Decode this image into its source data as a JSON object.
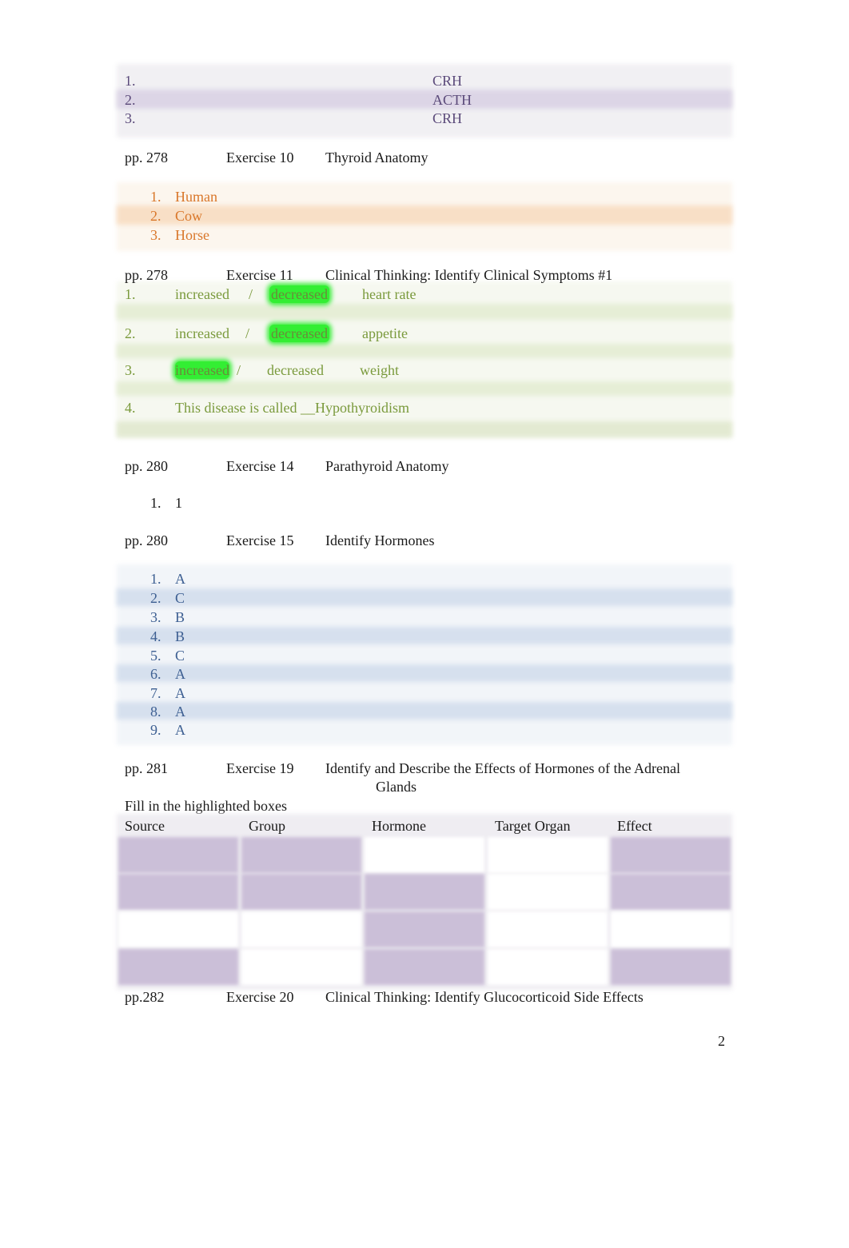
{
  "section_crh": {
    "items": [
      {
        "num": "1.",
        "answer": "CRH"
      },
      {
        "num": "2.",
        "answer": "ACTH"
      },
      {
        "num": "3.",
        "answer": "CRH"
      }
    ]
  },
  "ex10": {
    "page": "pp.  278",
    "exercise": "Exercise 10",
    "title": "Thyroid Anatomy",
    "items": [
      {
        "num": "1.",
        "answer": "Human"
      },
      {
        "num": "2.",
        "answer": "Cow"
      },
      {
        "num": "3.",
        "answer": "Horse"
      }
    ]
  },
  "ex11": {
    "page": "pp. 278",
    "exercise": "Exercise 11",
    "title": "Clinical Thinking: Identify Clinical Symptoms #1",
    "items": [
      {
        "num": "1.",
        "opt1": "increased",
        "sep": "/",
        "opt2": "decreased",
        "label": "heart rate",
        "selected": "decreased"
      },
      {
        "num": "2.",
        "opt1": "increased",
        "sep": "/",
        "opt2": "decreased",
        "label": "appetite",
        "selected": "decreased"
      },
      {
        "num": "3.",
        "opt1": "increased",
        "sep": "/",
        "opt2": "decreased",
        "label": "weight",
        "selected": "increased"
      }
    ],
    "item4": {
      "num": "4.",
      "text": "This disease is called __Hypothyroidism"
    }
  },
  "ex14": {
    "page": "pp.  280",
    "exercise": "Exercise 14",
    "title": "Parathyroid Anatomy",
    "items": [
      {
        "num": "1.",
        "answer": "1"
      }
    ]
  },
  "ex15": {
    "page": "pp.  280",
    "exercise": "Exercise 15",
    "title": "Identify Hormones",
    "items": [
      {
        "num": "1.",
        "answer": "A"
      },
      {
        "num": "2.",
        "answer": "C"
      },
      {
        "num": "3.",
        "answer": "B"
      },
      {
        "num": "4.",
        "answer": "B"
      },
      {
        "num": "5.",
        "answer": "C"
      },
      {
        "num": "6.",
        "answer": "A"
      },
      {
        "num": "7.",
        "answer": "A"
      },
      {
        "num": "8.",
        "answer": "A"
      },
      {
        "num": "9.",
        "answer": "A"
      }
    ]
  },
  "ex19": {
    "page": "pp. 281",
    "exercise": "Exercise 19",
    "title_line1": "Identify and Describe the Effects of Hormones of the Adrenal",
    "title_line2": "Glands",
    "instruction": "Fill in the highlighted boxes",
    "table": {
      "headers": [
        "Source",
        "Group",
        "Hormone",
        "Target Organ",
        "Effect"
      ],
      "highlighted": [
        [
          true,
          true,
          false,
          false,
          true
        ],
        [
          true,
          true,
          true,
          false,
          true
        ],
        [
          false,
          false,
          true,
          false,
          false
        ],
        [
          true,
          false,
          true,
          false,
          true
        ]
      ]
    }
  },
  "ex20": {
    "page": "pp.282",
    "exercise": "Exercise 20",
    "title": "Clinical Thinking: Identify Glucocorticoid Side Effects"
  },
  "footer": {
    "page_number": "2"
  },
  "colors": {
    "purple_highlight": "#cbbfd8",
    "orange_text": "#d9772a",
    "green_text": "#7a9a3c",
    "blue_text": "#3d5f92",
    "green_highlight": "#33ee33"
  }
}
